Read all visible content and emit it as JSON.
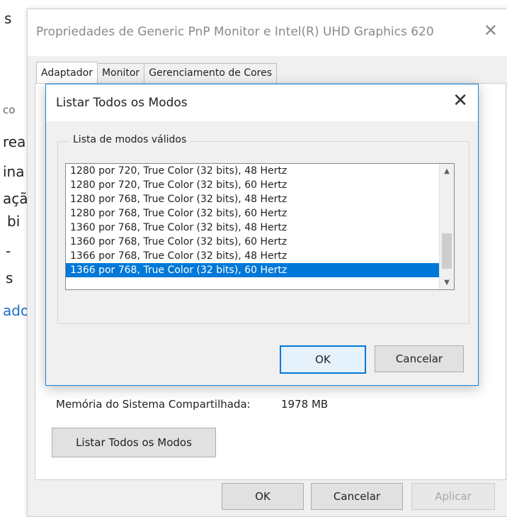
{
  "background": {
    "fragments": [
      "s",
      "co",
      "rea",
      "ina",
      "açã",
      "bi",
      "-",
      "s",
      "ado"
    ]
  },
  "outer_window": {
    "title": "Propriedades de Generic PnP Monitor e Intel(R) UHD Graphics 620",
    "close_glyph": "✕",
    "tabs": [
      {
        "label": "Adaptador",
        "active": true
      },
      {
        "label": "Monitor",
        "active": false
      },
      {
        "label": "Gerenciamento de Cores",
        "active": false
      }
    ],
    "shared_memory": {
      "label": "Memória do Sistema Compartilhada:",
      "value": "1978 MB"
    },
    "list_all_label": "Listar Todos os Modos",
    "ok_label": "OK",
    "cancel_label": "Cancelar",
    "apply_label": "Aplicar"
  },
  "modal": {
    "title": "Listar Todos os Modos",
    "close_glyph": "✕",
    "group_label": "Lista de modos válidos",
    "modes": [
      "1280 por 720, True Color (32 bits), 48 Hertz",
      "1280 por 720, True Color (32 bits), 60 Hertz",
      "1280 por 768, True Color (32 bits), 48 Hertz",
      "1280 por 768, True Color (32 bits), 60 Hertz",
      "1360 por 768, True Color (32 bits), 48 Hertz",
      "1360 por 768, True Color (32 bits), 60 Hertz",
      "1366 por 768, True Color (32 bits), 48 Hertz",
      "1366 por 768, True Color (32 bits), 60 Hertz"
    ],
    "selected_index": 7,
    "scroll_up_glyph": "▲",
    "scroll_down_glyph": "▼",
    "ok_label": "OK",
    "cancel_label": "Cancelar"
  },
  "colors": {
    "selection": "#0078d7",
    "dialog_border": "#1883d7",
    "link": "#1a73c9"
  }
}
